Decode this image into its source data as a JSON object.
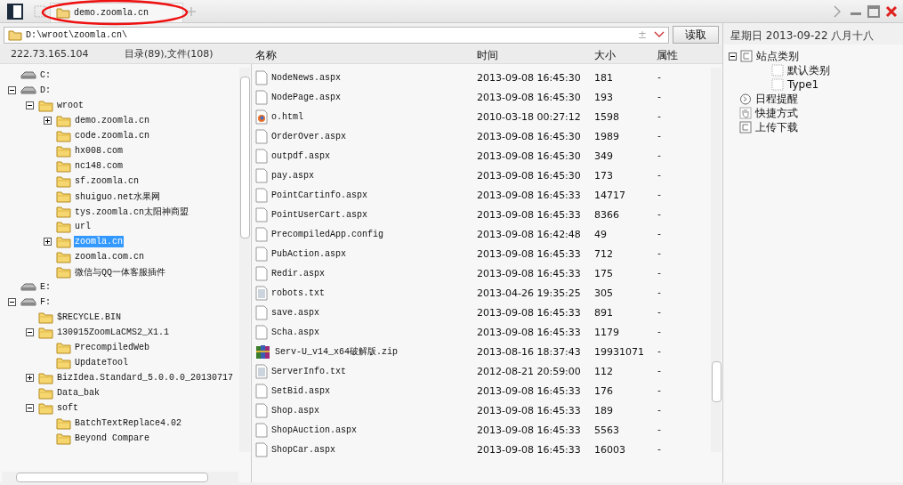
{
  "tabs": [
    {
      "label": "demo.zoomla.cn",
      "selected": true
    }
  ],
  "address": {
    "path": "D:\\wroot\\zoomla.cn\\",
    "toggle": "±",
    "read_button": "读取"
  },
  "date": "星期日 2013-09-22 八月十八",
  "info": {
    "ip": "222.73.165.104",
    "counts": "目录(89),文件(108)"
  },
  "tree": [
    {
      "label": "C:",
      "kind": "drive",
      "selected": false
    },
    {
      "label": "D:",
      "kind": "drive",
      "expanded": true,
      "selected": false,
      "children": [
        {
          "label": "wroot",
          "kind": "folder",
          "expanded": true,
          "selected": false,
          "children": [
            {
              "label": "demo.zoomla.cn",
              "kind": "folder",
              "expanded": false,
              "selected": false
            },
            {
              "label": "code.zoomla.cn",
              "kind": "folder",
              "selected": false
            },
            {
              "label": "hx008.com",
              "kind": "folder",
              "selected": false
            },
            {
              "label": "nc148.com",
              "kind": "folder",
              "selected": false
            },
            {
              "label": "sf.zoomla.cn",
              "kind": "folder",
              "selected": false
            },
            {
              "label": "shuiguo.net水果网",
              "kind": "folder",
              "selected": false
            },
            {
              "label": "tys.zoomla.cn太阳神商盟",
              "kind": "folder",
              "selected": false
            },
            {
              "label": "url",
              "kind": "folder",
              "selected": false
            },
            {
              "label": "zoomla.cn",
              "kind": "folder",
              "expanded": false,
              "selected": true
            },
            {
              "label": "zoomla.com.cn",
              "kind": "folder",
              "selected": false
            },
            {
              "label": "微信与QQ一体客服插件",
              "kind": "folder",
              "selected": false
            }
          ]
        }
      ]
    },
    {
      "label": "E:",
      "kind": "drive",
      "selected": false
    },
    {
      "label": "F:",
      "kind": "drive",
      "expanded": true,
      "selected": false,
      "children": [
        {
          "label": "$RECYCLE.BIN",
          "kind": "folder",
          "selected": false
        },
        {
          "label": "130915ZoomLaCMS2_X1.1",
          "kind": "folder",
          "expanded": true,
          "selected": false,
          "children": [
            {
              "label": "PrecompiledWeb",
              "kind": "folder",
              "selected": false
            },
            {
              "label": "UpdateTool",
              "kind": "folder",
              "selected": false
            }
          ]
        },
        {
          "label": "BizIdea.Standard_5.0.0.0_20130717",
          "kind": "folder",
          "expanded": false,
          "selected": false
        },
        {
          "label": "Data_bak",
          "kind": "folder",
          "selected": false
        },
        {
          "label": "soft",
          "kind": "folder",
          "expanded": true,
          "selected": false,
          "children": [
            {
              "label": "BatchTextReplace4.02",
              "kind": "folder",
              "selected": false
            },
            {
              "label": "Beyond Compare",
              "kind": "folder",
              "selected": false
            }
          ]
        }
      ]
    }
  ],
  "files": {
    "columns": [
      "名称",
      "时间",
      "大小",
      "属性"
    ],
    "rows": [
      {
        "kind": "file",
        "name": "NodeNews.aspx",
        "time": "2013-09-08 16:45:30",
        "size": "181",
        "attr": "-"
      },
      {
        "kind": "file",
        "name": "NodePage.aspx",
        "time": "2013-09-08 16:45:30",
        "size": "193",
        "attr": "-"
      },
      {
        "kind": "html",
        "name": "o.html",
        "time": "2010-03-18 00:27:12",
        "size": "1598",
        "attr": "-"
      },
      {
        "kind": "file",
        "name": "OrderOver.aspx",
        "time": "2013-09-08 16:45:30",
        "size": "1989",
        "attr": "-"
      },
      {
        "kind": "file",
        "name": "outpdf.aspx",
        "time": "2013-09-08 16:45:30",
        "size": "349",
        "attr": "-"
      },
      {
        "kind": "file",
        "name": "pay.aspx",
        "time": "2013-09-08 16:45:30",
        "size": "173",
        "attr": "-"
      },
      {
        "kind": "file",
        "name": "PointCartinfo.aspx",
        "time": "2013-09-08 16:45:33",
        "size": "14717",
        "attr": "-"
      },
      {
        "kind": "file",
        "name": "PointUserCart.aspx",
        "time": "2013-09-08 16:45:33",
        "size": "8366",
        "attr": "-"
      },
      {
        "kind": "file",
        "name": "PrecompiledApp.config",
        "time": "2013-09-08 16:42:48",
        "size": "49",
        "attr": "-"
      },
      {
        "kind": "file",
        "name": "PubAction.aspx",
        "time": "2013-09-08 16:45:33",
        "size": "712",
        "attr": "-"
      },
      {
        "kind": "file",
        "name": "Redir.aspx",
        "time": "2013-09-08 16:45:33",
        "size": "175",
        "attr": "-"
      },
      {
        "kind": "text",
        "name": "robots.txt",
        "time": "2013-04-26 19:35:25",
        "size": "305",
        "attr": "-"
      },
      {
        "kind": "file",
        "name": "save.aspx",
        "time": "2013-09-08 16:45:33",
        "size": "891",
        "attr": "-"
      },
      {
        "kind": "file",
        "name": "Scha.aspx",
        "time": "2013-09-08 16:45:33",
        "size": "1179",
        "attr": "-"
      },
      {
        "kind": "zip",
        "name": "Serv-U_v14_x64破解版.zip",
        "time": "2013-08-16 18:37:43",
        "size": "19931071",
        "attr": "-"
      },
      {
        "kind": "text",
        "name": "ServerInfo.txt",
        "time": "2012-08-21 20:59:00",
        "size": "112",
        "attr": "-"
      },
      {
        "kind": "file",
        "name": "SetBid.aspx",
        "time": "2013-09-08 16:45:33",
        "size": "176",
        "attr": "-"
      },
      {
        "kind": "file",
        "name": "Shop.aspx",
        "time": "2013-09-08 16:45:33",
        "size": "189",
        "attr": "-"
      },
      {
        "kind": "file",
        "name": "ShopAuction.aspx",
        "time": "2013-09-08 16:45:33",
        "size": "5563",
        "attr": "-"
      },
      {
        "kind": "file",
        "name": "ShopCar.aspx",
        "time": "2013-09-08 16:45:33",
        "size": "16003",
        "attr": "-"
      }
    ]
  },
  "side_tree": [
    {
      "label": "站点类别",
      "kind": "box",
      "expanded": true,
      "children": [
        {
          "label": "默认类别",
          "kind": "dotted"
        },
        {
          "label": "Type1",
          "kind": "dotted"
        }
      ]
    },
    {
      "label": "日程提醒",
      "kind": "clock"
    },
    {
      "label": "快捷方式",
      "kind": "hand"
    },
    {
      "label": "上传下载",
      "kind": "box"
    }
  ]
}
